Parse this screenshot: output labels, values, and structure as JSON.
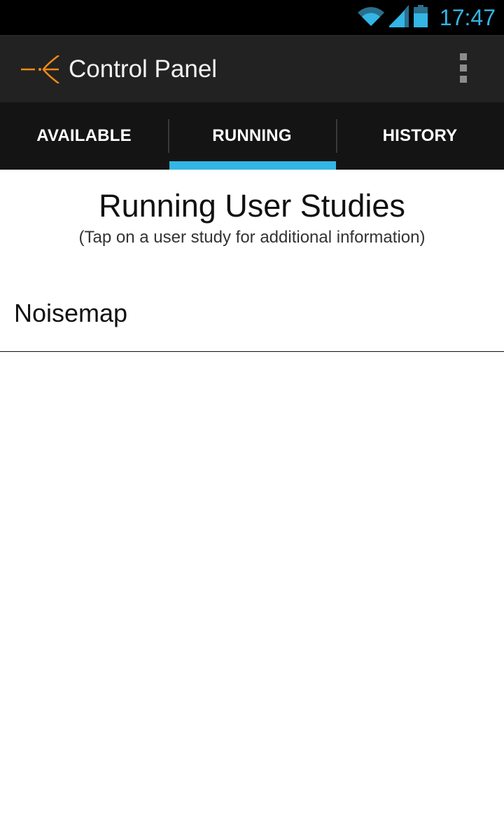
{
  "status_bar": {
    "time": "17:47",
    "icons": [
      "wifi-icon",
      "signal-icon",
      "battery-icon"
    ],
    "accent_color": "#33b5e5"
  },
  "action_bar": {
    "title": "Control Panel",
    "app_icon": "app-logo-icon",
    "overflow_icon": "overflow-menu-icon",
    "brand_color": "#f38a16"
  },
  "tabs": [
    {
      "label": "AVAILABLE",
      "selected": false
    },
    {
      "label": "RUNNING",
      "selected": true
    },
    {
      "label": "HISTORY",
      "selected": false
    }
  ],
  "main": {
    "title": "Running User Studies",
    "subtitle": "(Tap on a user study for additional information)",
    "studies": [
      {
        "name": "Noisemap"
      }
    ]
  }
}
